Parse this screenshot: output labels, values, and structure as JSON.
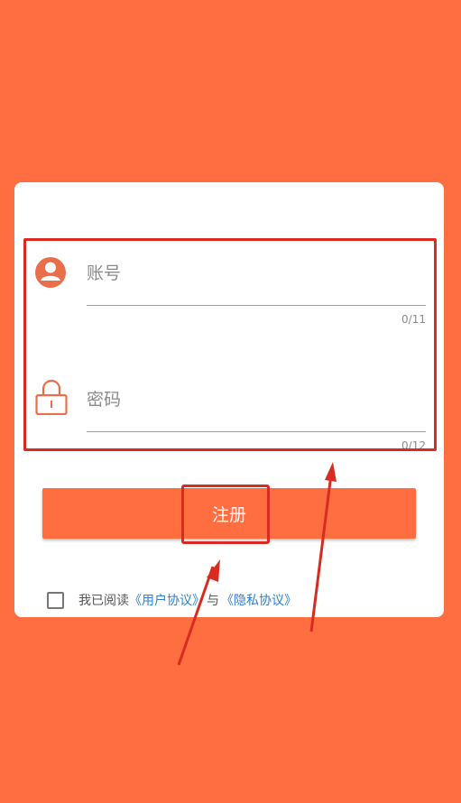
{
  "form": {
    "account": {
      "label": "账号",
      "counter": "0/11",
      "icon": "user-avatar-icon"
    },
    "password": {
      "label": "密码",
      "counter": "0/12",
      "icon": "lock-icon"
    },
    "register_button": "注册",
    "agreement": {
      "prefix": "我已阅读",
      "user_agreement": "《用户协议》",
      "connector": "与",
      "privacy_agreement": "《隐私协议》",
      "checked": false
    }
  },
  "colors": {
    "background": "#FF6E40",
    "accent": "#FF6E40",
    "annotation": "#D92B20",
    "link": "#2E7FD4"
  }
}
